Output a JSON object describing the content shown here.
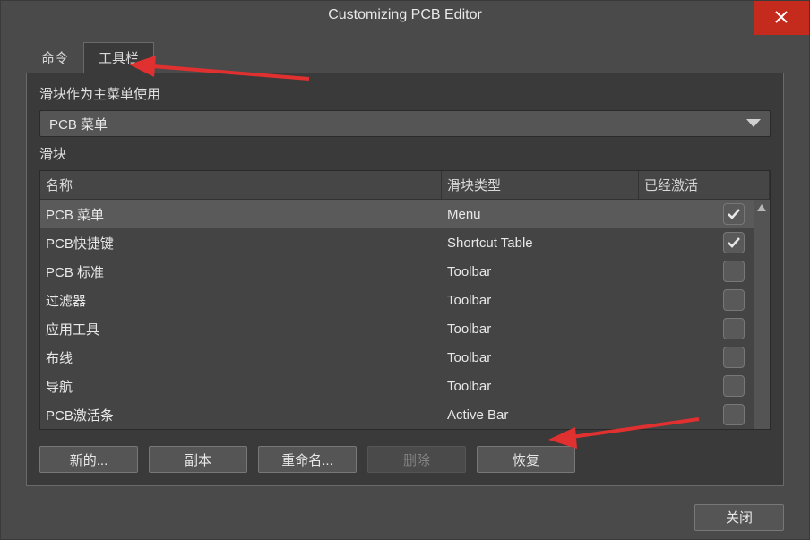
{
  "window": {
    "title": "Customizing PCB Editor"
  },
  "tabs": {
    "commands": "命令",
    "toolbars": "工具栏",
    "active": "toolbars"
  },
  "mainMenuSection": {
    "label": "滑块作为主菜单使用",
    "selected": "PCB 菜单"
  },
  "table": {
    "section_label": "滑块",
    "headers": {
      "name": "名称",
      "type": "滑块类型",
      "active": "已经激活"
    },
    "rows": [
      {
        "name": "PCB 菜单",
        "type": "Menu",
        "active": true,
        "selected": true
      },
      {
        "name": "PCB快捷键",
        "type": "Shortcut Table",
        "active": true,
        "selected": false
      },
      {
        "name": "PCB 标准",
        "type": "Toolbar",
        "active": false,
        "selected": false
      },
      {
        "name": "过滤器",
        "type": "Toolbar",
        "active": false,
        "selected": false
      },
      {
        "name": "应用工具",
        "type": "Toolbar",
        "active": false,
        "selected": false
      },
      {
        "name": "布线",
        "type": "Toolbar",
        "active": false,
        "selected": false
      },
      {
        "name": "导航",
        "type": "Toolbar",
        "active": false,
        "selected": false
      },
      {
        "name": "PCB激活条",
        "type": "Active Bar",
        "active": false,
        "selected": false
      }
    ]
  },
  "buttons": {
    "new": "新的...",
    "copy": "副本",
    "rename": "重命名...",
    "delete": "删除",
    "restore": "恢复",
    "close": "关闭"
  },
  "colors": {
    "accent_red": "#e03030",
    "close_red": "#c42b1c"
  }
}
